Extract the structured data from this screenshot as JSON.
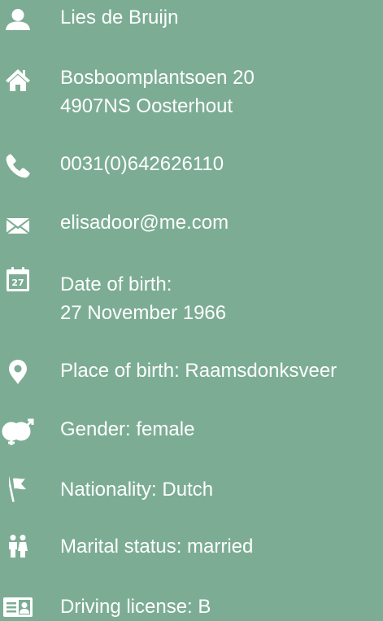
{
  "contact": {
    "name": "Lies de Bruijn",
    "address_line1": "Bosboomplantsoen 20",
    "address_line2": "4907NS Oosterhout",
    "phone": "0031(0)642626110",
    "email": "elisadoor@me.com",
    "dob_label": "Date of birth:",
    "dob_value": "27 November 1966",
    "calendar_day": "27",
    "place_of_birth": "Place of birth: Raamsdonksveer",
    "gender": "Gender: female",
    "nationality": "Nationality: Dutch",
    "marital_status": "Marital status: married",
    "driving_license": "Driving license: B"
  },
  "icons": {
    "name": "person-icon",
    "address": "home-icon",
    "phone": "phone-icon",
    "email": "envelope-icon",
    "dob": "calendar-icon",
    "place": "map-pin-icon",
    "gender": "gender-icon",
    "nationality": "flag-icon",
    "marital": "couple-icon",
    "license": "id-card-icon"
  },
  "colors": {
    "background": "#7cad94",
    "foreground": "#ffffff"
  }
}
